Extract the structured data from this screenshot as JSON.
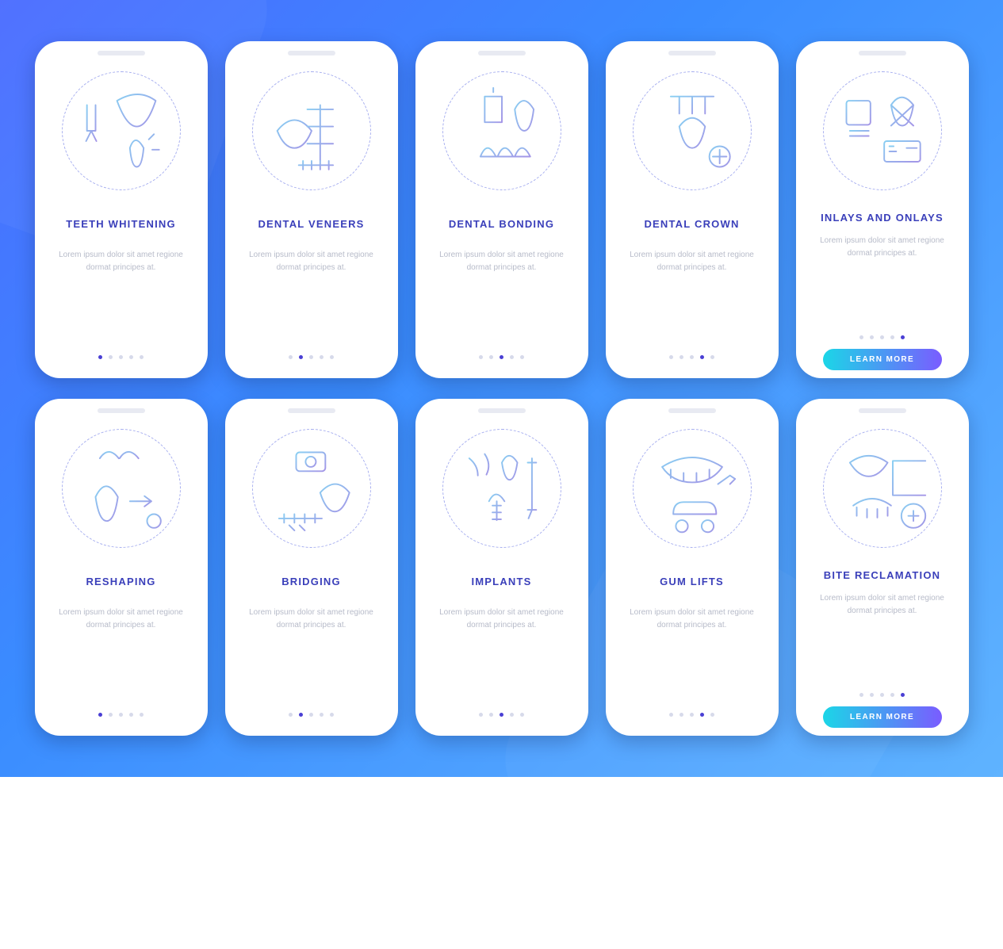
{
  "common": {
    "placeholder_desc": "Lorem ipsum dolor sit amet regione dormat principes at.",
    "learn_more_label": "LEARN MORE",
    "dot_count": 5,
    "colors": {
      "title": "#3a3fba",
      "desc": "#b7bbc9",
      "gradient_a": "#1bd6e7",
      "gradient_b": "#7a5cff"
    }
  },
  "screens": [
    {
      "title": "TEETH WHITENING",
      "icon": "teeth-whitening-icon",
      "active_index": 0,
      "has_button": false
    },
    {
      "title": "DENTAL VENEERS",
      "icon": "dental-veneers-icon",
      "active_index": 1,
      "has_button": false
    },
    {
      "title": "DENTAL BONDING",
      "icon": "dental-bonding-icon",
      "active_index": 2,
      "has_button": false
    },
    {
      "title": "DENTAL CROWN",
      "icon": "dental-crown-icon",
      "active_index": 3,
      "has_button": false
    },
    {
      "title": "INLAYS AND ONLAYS",
      "icon": "inlays-onlays-icon",
      "active_index": 4,
      "has_button": true
    },
    {
      "title": "RESHAPING",
      "icon": "reshaping-icon",
      "active_index": 0,
      "has_button": false
    },
    {
      "title": "BRIDGING",
      "icon": "bridging-icon",
      "active_index": 1,
      "has_button": false
    },
    {
      "title": "IMPLANTS",
      "icon": "implants-icon",
      "active_index": 2,
      "has_button": false
    },
    {
      "title": "GUM LIFTS",
      "icon": "gum-lifts-icon",
      "active_index": 3,
      "has_button": false
    },
    {
      "title": "BITE RECLAMATION",
      "icon": "bite-reclamation-icon",
      "active_index": 4,
      "has_button": true
    }
  ]
}
